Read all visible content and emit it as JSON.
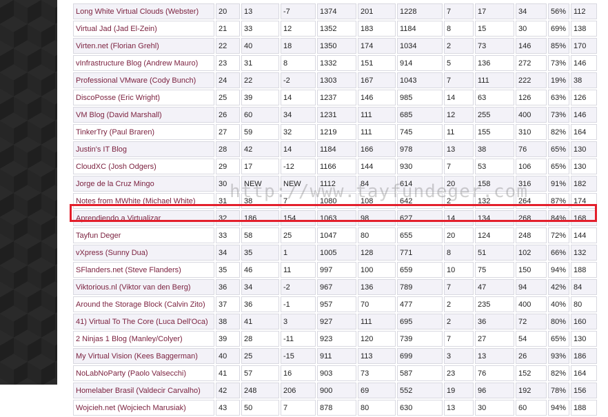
{
  "watermark": "http://www.tayfundeger.com",
  "rows": [
    [
      "Long White Virtual Clouds (Webster)",
      "20",
      "13",
      "-7",
      "1374",
      "201",
      "1228",
      "7",
      "17",
      "34",
      "56%",
      "112"
    ],
    [
      "Virtual Jad (Jad El-Zein)",
      "21",
      "33",
      "12",
      "1352",
      "183",
      "1184",
      "8",
      "15",
      "30",
      "69%",
      "138"
    ],
    [
      "Virten.net (Florian Grehl)",
      "22",
      "40",
      "18",
      "1350",
      "174",
      "1034",
      "2",
      "73",
      "146",
      "85%",
      "170"
    ],
    [
      "vInfrastructure Blog (Andrew Mauro)",
      "23",
      "31",
      "8",
      "1332",
      "151",
      "914",
      "5",
      "136",
      "272",
      "73%",
      "146"
    ],
    [
      "Professional VMware (Cody Bunch)",
      "24",
      "22",
      "-2",
      "1303",
      "167",
      "1043",
      "7",
      "111",
      "222",
      "19%",
      "38"
    ],
    [
      "DiscoPosse (Eric Wright)",
      "25",
      "39",
      "14",
      "1237",
      "146",
      "985",
      "14",
      "63",
      "126",
      "63%",
      "126"
    ],
    [
      "VM Blog (David Marshall)",
      "26",
      "60",
      "34",
      "1231",
      "111",
      "685",
      "12",
      "255",
      "400",
      "73%",
      "146"
    ],
    [
      "TinkerTry (Paul Braren)",
      "27",
      "59",
      "32",
      "1219",
      "111",
      "745",
      "11",
      "155",
      "310",
      "82%",
      "164"
    ],
    [
      "Justin's IT Blog",
      "28",
      "42",
      "14",
      "1184",
      "166",
      "978",
      "13",
      "38",
      "76",
      "65%",
      "130"
    ],
    [
      "CloudXC (Josh Odgers)",
      "29",
      "17",
      "-12",
      "1166",
      "144",
      "930",
      "7",
      "53",
      "106",
      "65%",
      "130"
    ],
    [
      "Jorge de la Cruz Mingo",
      "30",
      "NEW",
      "NEW",
      "1112",
      "84",
      "614",
      "20",
      "158",
      "316",
      "91%",
      "182"
    ],
    [
      "Notes from MWhite (Michael White)",
      "31",
      "38",
      "7",
      "1080",
      "108",
      "642",
      "2",
      "132",
      "264",
      "87%",
      "174"
    ],
    [
      "Aprendiendo a Virtualizar",
      "32",
      "186",
      "154",
      "1063",
      "98",
      "627",
      "14",
      "134",
      "268",
      "84%",
      "168"
    ],
    [
      "Tayfun Deger",
      "33",
      "58",
      "25",
      "1047",
      "80",
      "655",
      "20",
      "124",
      "248",
      "72%",
      "144"
    ],
    [
      "vXpress (Sunny Dua)",
      "34",
      "35",
      "1",
      "1005",
      "128",
      "771",
      "8",
      "51",
      "102",
      "66%",
      "132"
    ],
    [
      "SFlanders.net (Steve Flanders)",
      "35",
      "46",
      "11",
      "997",
      "100",
      "659",
      "10",
      "75",
      "150",
      "94%",
      "188"
    ],
    [
      "Viktorious.nl (Viktor van den Berg)",
      "36",
      "34",
      "-2",
      "967",
      "136",
      "789",
      "7",
      "47",
      "94",
      "42%",
      "84"
    ],
    [
      "Around the Storage Block (Calvin Zito)",
      "37",
      "36",
      "-1",
      "957",
      "70",
      "477",
      "2",
      "235",
      "400",
      "40%",
      "80"
    ],
    [
      "41) Virtual To The Core (Luca Dell'Oca)",
      "38",
      "41",
      "3",
      "927",
      "111",
      "695",
      "2",
      "36",
      "72",
      "80%",
      "160"
    ],
    [
      "2 Ninjas 1 Blog (Manley/Colyer)",
      "39",
      "28",
      "-11",
      "923",
      "120",
      "739",
      "7",
      "27",
      "54",
      "65%",
      "130"
    ],
    [
      "My Virtual Vision (Kees Baggerman)",
      "40",
      "25",
      "-15",
      "911",
      "113",
      "699",
      "3",
      "13",
      "26",
      "93%",
      "186"
    ],
    [
      "NoLabNoParty (Paolo Valsecchi)",
      "41",
      "57",
      "16",
      "903",
      "73",
      "587",
      "23",
      "76",
      "152",
      "82%",
      "164"
    ],
    [
      "Homelaber Brasil (Valdecir Carvalho)",
      "42",
      "248",
      "206",
      "900",
      "69",
      "552",
      "19",
      "96",
      "192",
      "78%",
      "156"
    ],
    [
      "Wojcieh.net (Wojciech Marusiak)",
      "43",
      "50",
      "7",
      "878",
      "80",
      "630",
      "13",
      "30",
      "60",
      "94%",
      "188"
    ]
  ],
  "highlight_row": 13,
  "colors": {
    "highlight": "#e31e2b",
    "link": "#7a1f3d"
  }
}
